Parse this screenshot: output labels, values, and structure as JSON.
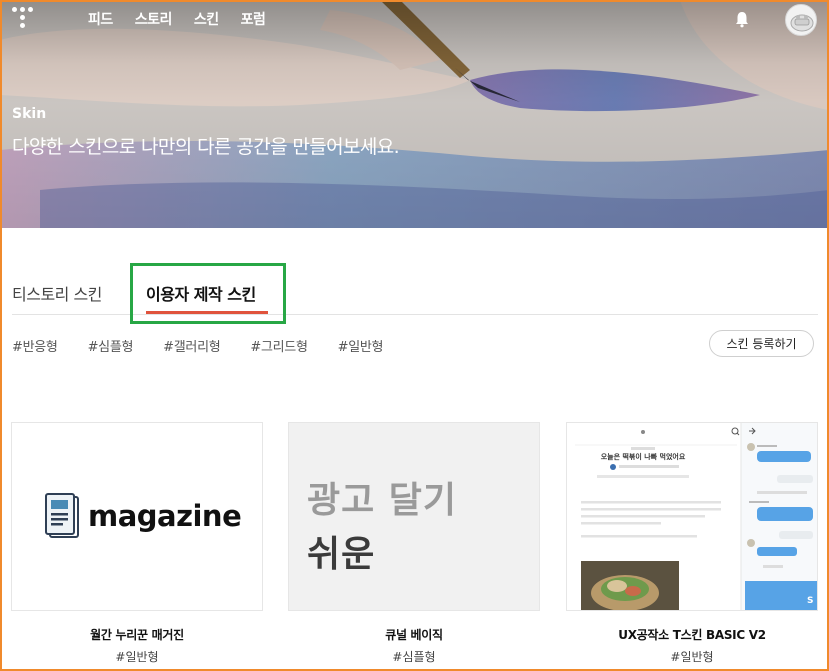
{
  "nav": {
    "links": [
      "피드",
      "스토리",
      "스킨",
      "포럼"
    ]
  },
  "hero": {
    "label": "Skin",
    "title": "다양한 스킨으로 나만의 다른 공간을 만들어보세요."
  },
  "tabs": {
    "default_label": "티스토리 스킨",
    "active_label": "이용자 제작 스킨"
  },
  "filters": [
    "#반응형",
    "#심플형",
    "#갤러리형",
    "#그리드형",
    "#일반형"
  ],
  "register_button": "스킨 등록하기",
  "cards": [
    {
      "name": "월간 누리꾼 매거진",
      "tag": "#일반형",
      "thumb_text": "magazine"
    },
    {
      "name": "큐널 베이직",
      "tag": "#심플형",
      "thumb_line1": "광고 달기",
      "thumb_line2": "쉬운"
    },
    {
      "name": "UX공작소 T스킨 BASIC V2",
      "tag": "#일반형",
      "thumb_title": "오늘은 떡볶이 나빠 먹었어요"
    }
  ],
  "colors": {
    "active_underline": "#e0533c",
    "highlight_box": "#28a745",
    "frame": "#f08a2c"
  }
}
